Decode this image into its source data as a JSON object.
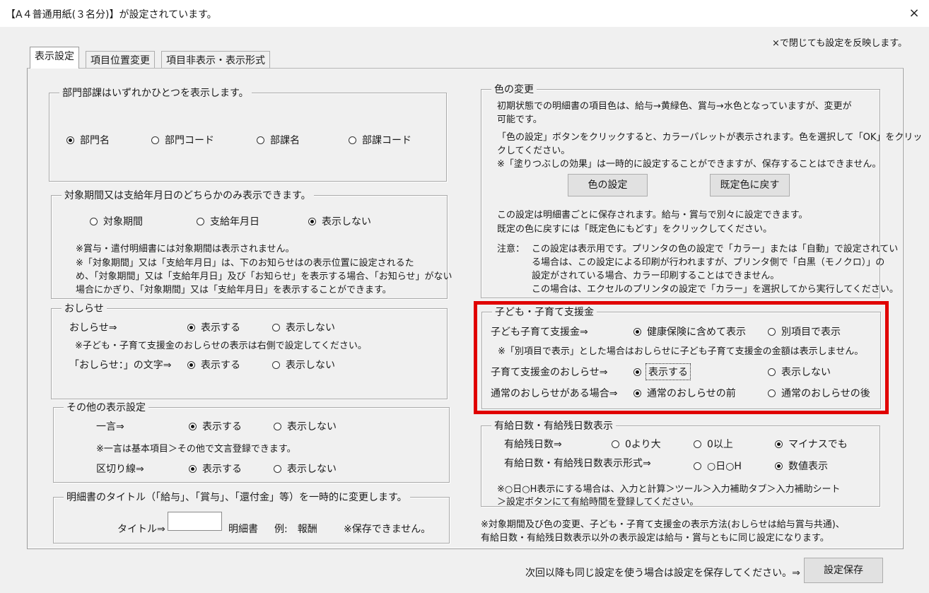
{
  "window": {
    "title": "【A４普通用紙(３名分)】が設定されています。",
    "close": "×"
  },
  "top_note": "×で閉じても設定を反映します。",
  "tabs": [
    "表示設定",
    "項目位置変更",
    "項目非表示・表示形式"
  ],
  "dept": {
    "legend": "部門部課はいずれかひとつを表示します。",
    "options": [
      "部門名",
      "部門コード",
      "部課名",
      "部課コード"
    ],
    "selected": "部門名"
  },
  "period": {
    "legend": "対象期間又は支給年月日のどちらかのみ表示できます。",
    "options": [
      "対象期間",
      "支給年月日",
      "表示しない"
    ],
    "selected": "表示しない",
    "notes": [
      "※賞与・遣付明細書には対象期間は表示されません。",
      "※「対象期間」又は「支給年月日」は、下のお知らせはの表示位置に設定されるた",
      "め、「対象期間」又は「支給年月日」及び「お知らせ」を表示する場合、「お知らせ」がない",
      "場合にかぎり、「対象期間」又は「支給年月日」を表示することができます。"
    ]
  },
  "notice": {
    "legend": "おしらせ",
    "row1_label": "おしらせ⇒",
    "note": "※子ども・子育て支援金のおしらせの表示は右側で設定してください。",
    "row2_label": "「おしらせ：」の文字⇒",
    "on": "表示する",
    "off": "表示しない"
  },
  "other": {
    "legend": "その他の表示設定",
    "row1_label": "一言⇒",
    "note": "※一言は基本項目＞その他で文言登録できます。",
    "row2_label": "区切り線⇒",
    "on": "表示する",
    "off": "表示しない"
  },
  "title_change": {
    "legend": "明細書のタイトル（「給与」、「賞与」、「還付金」等）を一時的に変更します。",
    "label": "タイトル⇒",
    "input_value": "",
    "suffix": "明細書",
    "example": "例:　報酬",
    "note": "※保存できません。"
  },
  "color": {
    "legend": "色の変更",
    "lines1": [
      "初期状態での明細書の項目色は、給与→黄緑色、賞与→水色となっていますが、変更が",
      "可能です。"
    ],
    "lines2": [
      "「色の設定」ボタンをクリックすると、カラーパレットが表示されます。色を選択して「OK」をクリッ",
      "クしてください。",
      "※「塗りつぶしの効果」は一時的に設定することができますが、保存することはできません。"
    ],
    "btn_set": "色の設定",
    "btn_reset": "既定色に戻す",
    "lines3": [
      "この設定は明細書ごとに保存されます。給与・賞与で別々に設定できます。",
      "既定の色に戻すには「既定色にもどす」をクリックしてください。"
    ],
    "caution_label": "注意：",
    "caution": [
      "この設定は表示用です。プリンタの色の設定で「カラー」または「自動」で設定されてい",
      "る場合は、この設定による印刷が行われますが、プリンタ側で「白黒（モノクロ）」の",
      "設定がされている場合、カラー印刷することはできません。",
      "この場合は、エクセルのプリンタの設定で「カラー」を選択してから実行してください。"
    ]
  },
  "child": {
    "legend": "子ども・子育て支援金",
    "row1_label": "子ども子育て支援金⇒",
    "row1_opts": [
      "健康保険に含めて表示",
      "別項目で表示"
    ],
    "note": "※「別項目で表示」とした場合はおしらせに子ども子育て支援金の金額は表示しません。",
    "row2_label": "子育て支援金のおしらせ⇒",
    "row2_opts": [
      "表示する",
      "表示しない"
    ],
    "row3_label": "通常のおしらせがある場合⇒",
    "row3_opts": [
      "通常のおしらせの前",
      "通常のおしらせの後"
    ],
    "highlight_color": "#e00000"
  },
  "paid": {
    "legend": "有給日数・有給残日数表示",
    "row1_label": "有給残日数⇒",
    "row1_opts": [
      "0より大",
      "0以上",
      "マイナスでも"
    ],
    "row2_label": "有給日数・有給残日数表示形式⇒",
    "row2_opts": [
      "○日○H",
      "数値表示"
    ],
    "notes": [
      "※○日○H表示にする場合は、入力と計算＞ツール＞入力補助タブ＞入力補助シート",
      "＞設定ボタンにて有給時間を登録してください。"
    ]
  },
  "bottom_notes": [
    "※対象期間及び色の変更、子ども・子育て支援金の表示方法(おしらせは給与賞与共通)、",
    "有給日数・有給残日数表示以外の表示設定は給与・賞与ともに同じ設定になります。"
  ],
  "footer": {
    "text": "次回以降も同じ設定を使う場合は設定を保存してください。⇒",
    "save": "設定保存"
  }
}
